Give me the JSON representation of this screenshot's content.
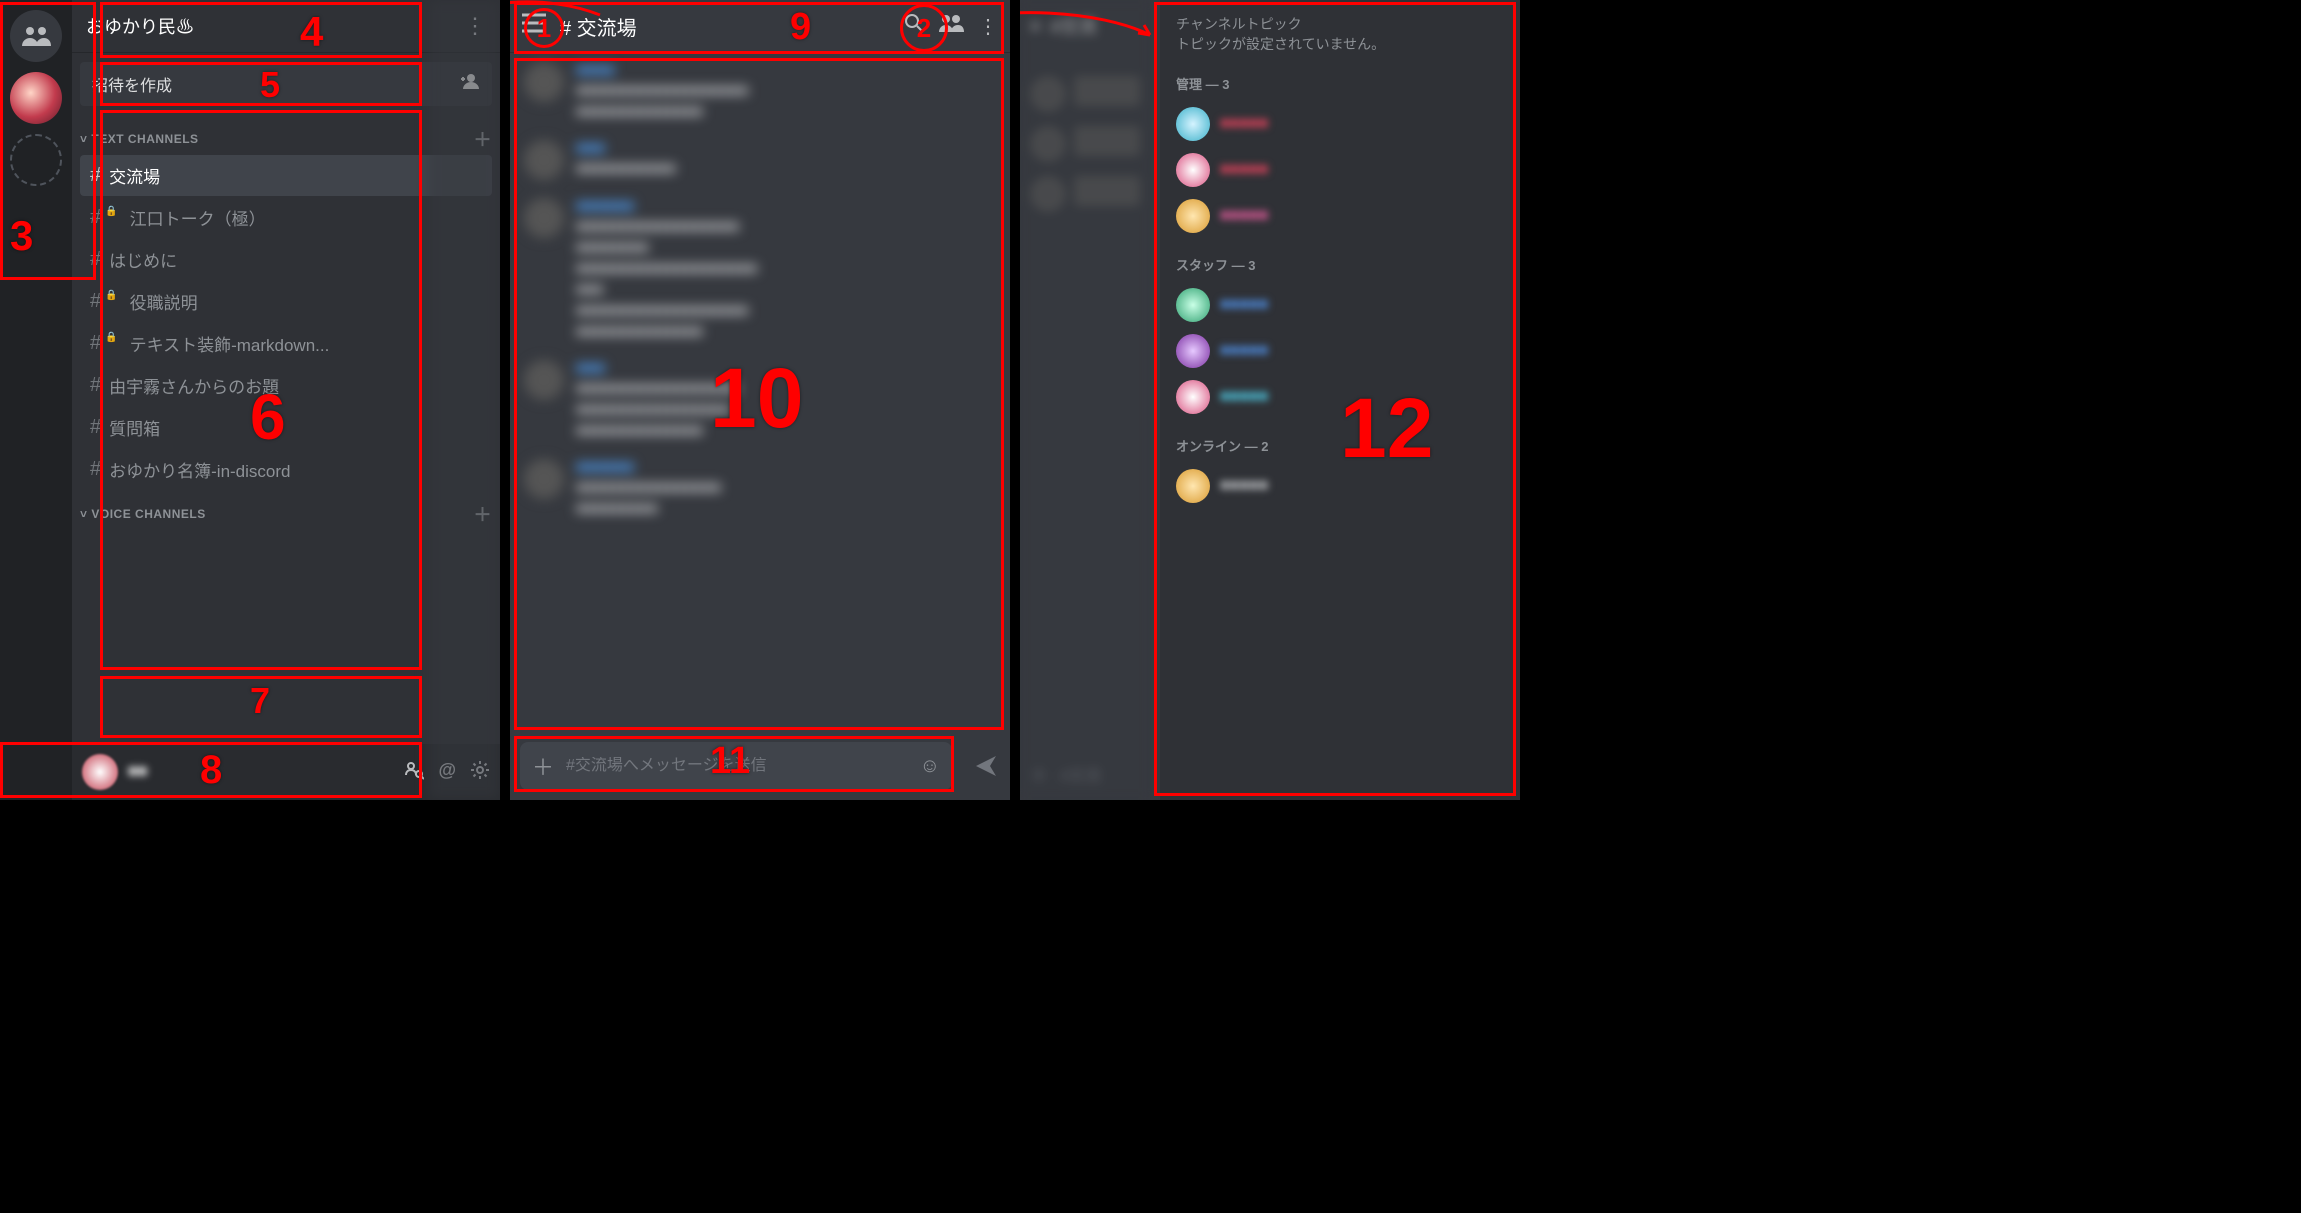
{
  "screen1": {
    "server_name": "おゆかり民♨",
    "invite_label": "招待を作成",
    "text_channels_header": "TEXT CHANNELS",
    "voice_channels_header": "VOICE CHANNELS",
    "channels": [
      {
        "label": "交流場",
        "locked": false,
        "active": true
      },
      {
        "label": "江口トーク（極）",
        "locked": true,
        "active": false
      },
      {
        "label": "はじめに",
        "locked": false,
        "active": false
      },
      {
        "label": "役職説明",
        "locked": true,
        "active": false
      },
      {
        "label": "テキスト装飾-markdown...",
        "locked": true,
        "active": false
      },
      {
        "label": "由宇霧さんからのお題",
        "locked": false,
        "active": false
      },
      {
        "label": "質問箱",
        "locked": false,
        "active": false
      },
      {
        "label": "おゆかり名簿-in-discord",
        "locked": false,
        "active": false
      }
    ],
    "user_name": "■■"
  },
  "screen2": {
    "channel_title": "# 交流場",
    "composer_placeholder": "#交流場へメッセージを送信"
  },
  "screen3": {
    "header_text": "#交流",
    "topic_label": "チャンネルトピック",
    "topic_text": "トピックが設定されていません。",
    "roles": [
      {
        "name": "管理",
        "count": 3,
        "members": [
          {
            "color": "name-red",
            "ava": "ava-a"
          },
          {
            "color": "name-red",
            "ava": "ava-b"
          },
          {
            "color": "name-pink",
            "ava": "ava-c"
          }
        ]
      },
      {
        "name": "スタッフ",
        "count": 3,
        "members": [
          {
            "color": "name-blue",
            "ava": "ava-d"
          },
          {
            "color": "name-blue",
            "ava": "ava-e"
          },
          {
            "color": "name-cyan",
            "ava": "ava-b"
          }
        ]
      },
      {
        "name": "オンライン",
        "count": 2,
        "members": [
          {
            "color": "name-gray",
            "ava": "ava-c"
          }
        ]
      }
    ]
  },
  "annotations": {
    "n1": "1",
    "n2": "2",
    "n3": "3",
    "n4": "4",
    "n5": "5",
    "n6": "6",
    "n7": "7",
    "n8": "8",
    "n9": "9",
    "n10": "10",
    "n11": "11",
    "n12": "12"
  }
}
